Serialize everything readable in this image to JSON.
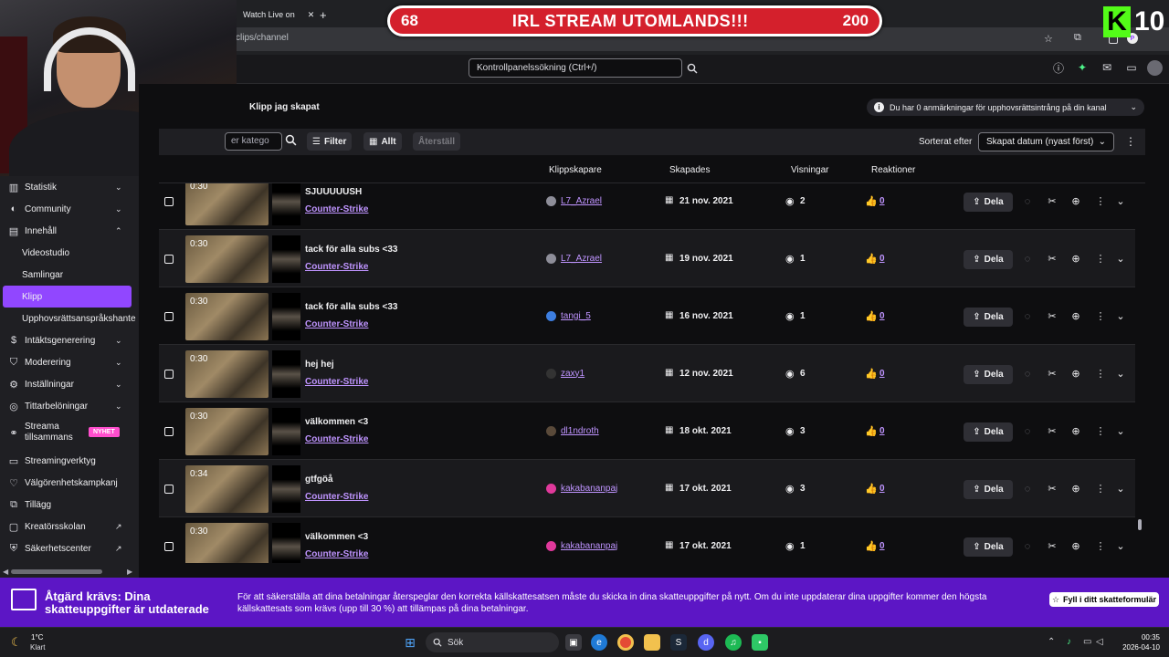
{
  "browser": {
    "tab_title": "Watch Live on",
    "url": "clips/channel"
  },
  "overlay": {
    "left_num": "68",
    "title": "IRL STREAM UTOMLANDS!!!",
    "right_num": "200",
    "kick_letter": "K",
    "kick_number": "10"
  },
  "topbar": {
    "search_placeholder": "Kontrollpanelssökning (Ctrl+/)"
  },
  "sidebar": {
    "items": [
      {
        "label": "Statistik",
        "icon": "bar-chart-icon"
      },
      {
        "label": "Community",
        "icon": "people-icon"
      },
      {
        "label": "Innehåll",
        "icon": "content-icon"
      },
      {
        "label": "Videostudio"
      },
      {
        "label": "Samlingar"
      },
      {
        "label": "Klipp"
      },
      {
        "label": "Upphovsrättsanspråkshante"
      },
      {
        "label": "Intäktsgenerering",
        "icon": "coin-icon"
      },
      {
        "label": "Moderering",
        "icon": "shield-icon"
      },
      {
        "label": "Inställningar",
        "icon": "gear-icon"
      },
      {
        "label": "Tittarbelöningar",
        "icon": "reward-icon"
      },
      {
        "label": "Streama tillsammans",
        "icon": "collab-icon"
      },
      {
        "label": "Streamingverktyg",
        "icon": "tools-icon"
      },
      {
        "label": "Välgörenhetskampkanj",
        "icon": "charity-icon"
      },
      {
        "label": "Tillägg",
        "icon": "extension-icon"
      },
      {
        "label": "Kreatörsskolan",
        "icon": "school-icon"
      },
      {
        "label": "Säkerhetscenter",
        "icon": "safety-icon"
      }
    ],
    "new_badge": "NYHET"
  },
  "main": {
    "title": "Klipp jag skapat",
    "copyright_notice": "Du har 0 anmärkningar för upphovsrättsintrång på din kanal",
    "category_search": "er katego",
    "filter_label": "Filter",
    "all_label": "Allt",
    "reset_label": "Återställ",
    "sort_label": "Sorterat efter",
    "sort_value": "Skapat datum (nyast först)",
    "columns": {
      "creator": "Klippskapare",
      "created": "Skapades",
      "views": "Visningar",
      "reactions": "Reaktioner"
    },
    "share_label": "Dela"
  },
  "clips": [
    {
      "duration": "0:30",
      "title": "SJUUUUUSH",
      "game": "Counter-Strike",
      "creator": "L7_Azrael",
      "date": "21 nov. 2021",
      "views": "2",
      "reactions": "0",
      "avatar_color": "#8e8e99"
    },
    {
      "duration": "0:30",
      "title": "tack för alla subs <33",
      "game": "Counter-Strike",
      "creator": "L7_Azrael",
      "date": "19 nov. 2021",
      "views": "1",
      "reactions": "0",
      "avatar_color": "#8e8e99"
    },
    {
      "duration": "0:30",
      "title": "tack för alla subs <33",
      "game": "Counter-Strike",
      "creator": "tangi_5",
      "date": "16 nov. 2021",
      "views": "1",
      "reactions": "0",
      "avatar_color": "#3d7ee0"
    },
    {
      "duration": "0:30",
      "title": "hej hej",
      "game": "Counter-Strike",
      "creator": "zaxy1",
      "date": "12 nov. 2021",
      "views": "6",
      "reactions": "0",
      "avatar_color": "#333"
    },
    {
      "duration": "0:30",
      "title": "välkommen <3",
      "game": "Counter-Strike",
      "creator": "dl1ndroth",
      "date": "18 okt. 2021",
      "views": "3",
      "reactions": "0",
      "avatar_color": "#5a4a3a"
    },
    {
      "duration": "0:34",
      "title": "gtfgöå",
      "game": "Counter-Strike",
      "creator": "kakabananpaj",
      "date": "17 okt. 2021",
      "views": "3",
      "reactions": "0",
      "avatar_color": "#e0399b"
    },
    {
      "duration": "0:30",
      "title": "välkommen <3",
      "game": "Counter-Strike",
      "creator": "kakabananpaj",
      "date": "17 okt. 2021",
      "views": "1",
      "reactions": "0",
      "avatar_color": "#e0399b"
    }
  ],
  "tax_banner": {
    "title": "Åtgärd krävs: Dina skatteuppgifter är utdaterade",
    "body": "För att säkerställa att dina betalningar återspeglar den korrekta källskattesatsen måste du skicka in dina skatteuppgifter på nytt. Om du inte uppdaterar dina uppgifter kommer den högsta källskattesats som krävs (upp till 30 %) att tillämpas på dina betalningar.",
    "button": "Fyll i ditt skatteformulär"
  },
  "taskbar": {
    "temperature": "1°C",
    "weather": "Klart",
    "search": "Sök",
    "time": "00:35",
    "date": "2026-04-10"
  },
  "colors": {
    "accent": "#9147ff",
    "banner": "#5c16c5",
    "overlay_red": "#d4202c",
    "kick_green": "#53fc18"
  }
}
